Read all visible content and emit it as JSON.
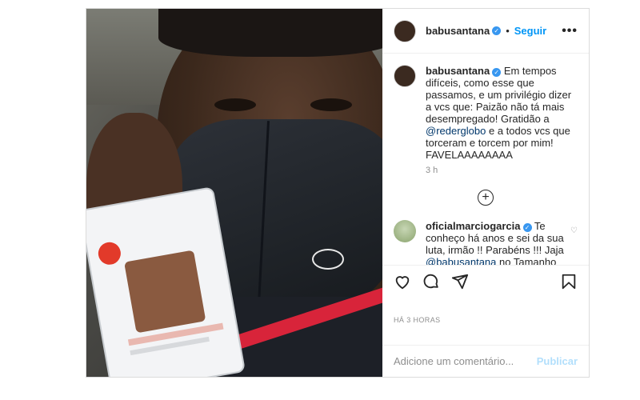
{
  "header": {
    "username": "babusantana",
    "separator": "•",
    "follow_label": "Seguir",
    "more_label": "•••"
  },
  "caption": {
    "username": "babusantana",
    "text_1": "Em tempos difíceis, como esse que passamos, e um privilégio dizer a vcs que: Paizão não tá mais desempregado! Gratidão a ",
    "mention": "@rederglobo",
    "text_2": " e a todos vcs que torceram e torcem por mim! FAVELAAAAAAAA",
    "time": "3 h"
  },
  "load_more_label": "+",
  "comment": {
    "username": "oficialmarciogarcia",
    "text_1": " Te conheço há anos e sei da sua luta, irmão !! Parabéns !!! Jaja ",
    "mention": "@babusantana",
    "text_2": " no Tamanho Família !!!! 👏🏽👏🏽👏🏽👏🏽💪🏽❤️"
  },
  "posted_time": "HÁ 3 HORAS",
  "comment_box": {
    "placeholder": "Adicione um comentário...",
    "publish_label": "Publicar"
  },
  "colors": {
    "accent": "#0095f6",
    "verified": "#3897f0",
    "publish_disabled": "#b2dffc",
    "mask_red": "#d8243a"
  },
  "icons": {
    "verified": "verified-badge-icon",
    "like": "heart-icon",
    "comment": "comment-icon",
    "share": "paper-plane-icon",
    "save": "bookmark-icon",
    "options": "more-icon",
    "load_more": "plus-circle-icon"
  }
}
